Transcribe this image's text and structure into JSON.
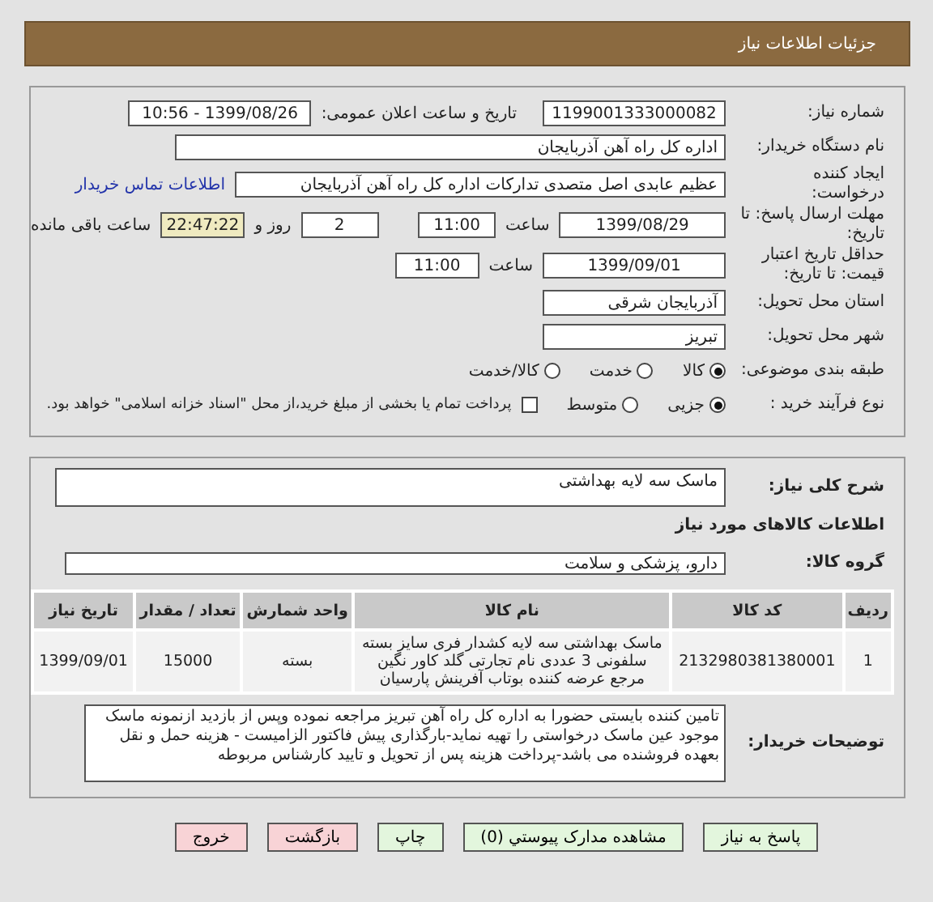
{
  "header": {
    "title": "جزئیات اطلاعات نیاز"
  },
  "details": {
    "need_number": {
      "label": "شماره نیاز:",
      "value": "1199001333000082"
    },
    "announce": {
      "label": "تاریخ و ساعت اعلان عمومی:",
      "value": "1399/08/26 - 10:56"
    },
    "buyer_org": {
      "label": "نام دستگاه خریدار:",
      "value": "اداره کل راه آهن آذربایجان"
    },
    "requester": {
      "label": "ایجاد کننده درخواست:",
      "value": "عظیم عابدی اصل متصدی تدارکات اداره کل راه آهن آذربایجان",
      "link": "اطلاعات تماس خریدار"
    },
    "deadline": {
      "label": "مهلت ارسال پاسخ: تا تاریخ:",
      "date": "1399/08/29",
      "time_label": "ساعت",
      "time": "11:00",
      "days": "2",
      "days_label": "روز و",
      "remaining": "22:47:22",
      "remaining_label": "ساعت باقی مانده"
    },
    "validity": {
      "label": "حداقل تاریخ اعتبار قیمت: تا تاریخ:",
      "date": "1399/09/01",
      "time_label": "ساعت",
      "time": "11:00"
    },
    "province": {
      "label": "استان محل تحویل:",
      "value": "آذربایجان شرقی"
    },
    "city": {
      "label": "شهر محل تحویل:",
      "value": "تبریز"
    },
    "category": {
      "label": "طبقه بندی موضوعی:",
      "options": [
        {
          "label": "کالا",
          "selected": true
        },
        {
          "label": "خدمت",
          "selected": false
        },
        {
          "label": "کالا/خدمت",
          "selected": false
        }
      ]
    },
    "process": {
      "label": "نوع فرآیند خرید :",
      "options": [
        {
          "label": "جزیی",
          "selected": true
        },
        {
          "label": "متوسط",
          "selected": false
        }
      ],
      "treasury": {
        "label": "پرداخت تمام یا بخشی از مبلغ خرید،از محل \"اسناد خزانه اسلامی\" خواهد بود.",
        "checked": false
      }
    }
  },
  "needs": {
    "description": {
      "label": "شرح کلی نیاز:",
      "value": "ماسک سه لایه بهداشتی"
    },
    "goods_heading": "اطلاعات کالاهای مورد نیاز",
    "goods_group": {
      "label": "گروه کالا:",
      "value": "دارو، پزشکی و سلامت"
    },
    "table": {
      "columns": [
        "ردیف",
        "کد کالا",
        "نام کالا",
        "واحد شمارش",
        "تعداد / مقدار",
        "تاریخ نیاز"
      ],
      "rows": [
        [
          "1",
          "2132980381380001",
          "ماسک بهداشتی سه لایه کشدار فری سایز بسته سلفونی 3 عددی نام تجارتی گلد کاور نگین مرجع عرضه کننده بوتاب آفرینش پارسیان",
          "بسته",
          "15000",
          "1399/09/01"
        ]
      ]
    },
    "buyer_notes": {
      "label": "توضیحات خریدار:",
      "value": "تامین کننده بایستی حضورا به اداره کل راه آهن تبریز مراجعه نموده وپس از بازدید ازنمونه ماسک موجود عین ماسک درخواستی را تهیه نماید-بارگذاری پیش فاکتور الزامیست - هزینه حمل و نقل بعهده فروشنده می باشد-پرداخت هزینه پس از تحویل و تایید کارشناس مربوطه"
    }
  },
  "buttons": [
    {
      "label": "پاسخ به نیاز",
      "kind": "action"
    },
    {
      "label": "مشاهده مدارک پیوستي (0)",
      "kind": "action"
    },
    {
      "label": "چاپ",
      "kind": "action"
    },
    {
      "label": "بازگشت",
      "kind": "exit"
    },
    {
      "label": "خروج",
      "kind": "exit"
    }
  ]
}
